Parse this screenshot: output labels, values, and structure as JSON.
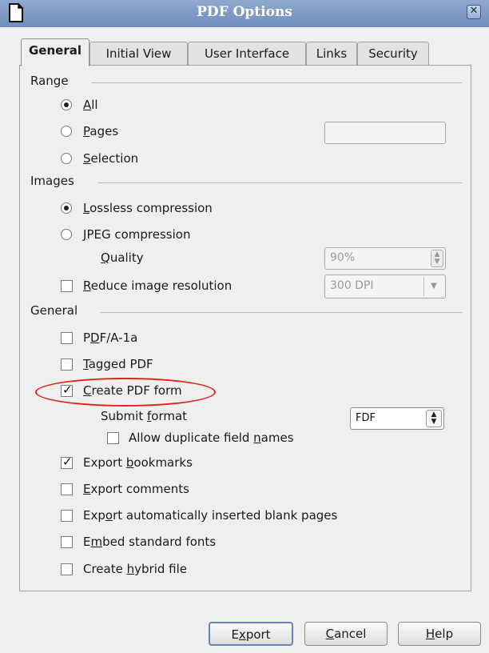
{
  "window": {
    "title": "PDF Options",
    "close_symbol": "✕",
    "app_icon": "document-icon"
  },
  "tabs": [
    {
      "label": "General",
      "active": true
    },
    {
      "label": "Initial View",
      "active": false
    },
    {
      "label": "User Interface",
      "active": false
    },
    {
      "label": "Links",
      "active": false
    },
    {
      "label": "Security",
      "active": false
    }
  ],
  "range": {
    "heading": "Range",
    "all": {
      "pre": "",
      "key": "A",
      "post": "ll",
      "selected": true
    },
    "pages": {
      "pre": "",
      "key": "P",
      "post": "ages",
      "selected": false,
      "value": ""
    },
    "selection": {
      "pre": "",
      "key": "S",
      "post": "election",
      "selected": false
    }
  },
  "images": {
    "heading": "Images",
    "lossless": {
      "pre": "",
      "key": "L",
      "post": "ossless compression",
      "selected": true
    },
    "jpeg": {
      "pre": "",
      "key": "J",
      "post": "PEG compression",
      "selected": false
    },
    "quality": {
      "pre": "",
      "key": "Q",
      "post": "uality",
      "value": "90%"
    },
    "reduce": {
      "pre": "",
      "key": "R",
      "post": "educe image resolution",
      "checked": false,
      "value": "300 DPI"
    }
  },
  "general": {
    "heading": "General",
    "pdfa": {
      "pre": "P",
      "key": "D",
      "post": "F/A-1a",
      "checked": false
    },
    "tagged": {
      "pre": "",
      "key": "T",
      "post": "agged PDF",
      "checked": false
    },
    "create_form": {
      "pre": "",
      "key": "C",
      "post": "reate PDF form",
      "checked": true
    },
    "submit_format": {
      "pre": "Submit ",
      "key": "f",
      "post": "ormat",
      "value": "FDF"
    },
    "allow_dup": {
      "pre": "Allow duplicate field ",
      "key": "n",
      "post": "ames",
      "checked": false
    },
    "bookmarks": {
      "pre": "Export ",
      "key": "b",
      "post": "ookmarks",
      "checked": true
    },
    "comments": {
      "pre": "",
      "key": "E",
      "post": "xport comments",
      "checked": false
    },
    "blank_pages": {
      "pre": "Exp",
      "key": "o",
      "post": "rt automatically inserted blank pages",
      "checked": false
    },
    "embed_fonts": {
      "pre": "E",
      "key": "m",
      "post": "bed standard fonts",
      "checked": false
    },
    "hybrid": {
      "pre": "Create ",
      "key": "h",
      "post": "ybrid file",
      "checked": false
    }
  },
  "buttons": {
    "export": {
      "pre": "E",
      "key": "x",
      "post": "port"
    },
    "cancel": {
      "pre": "",
      "key": "C",
      "post": "ancel"
    },
    "help": {
      "pre": "",
      "key": "H",
      "post": "elp"
    }
  },
  "colors": {
    "titlebar": "#7d99c5",
    "highlight_ellipse": "#e0241c"
  }
}
